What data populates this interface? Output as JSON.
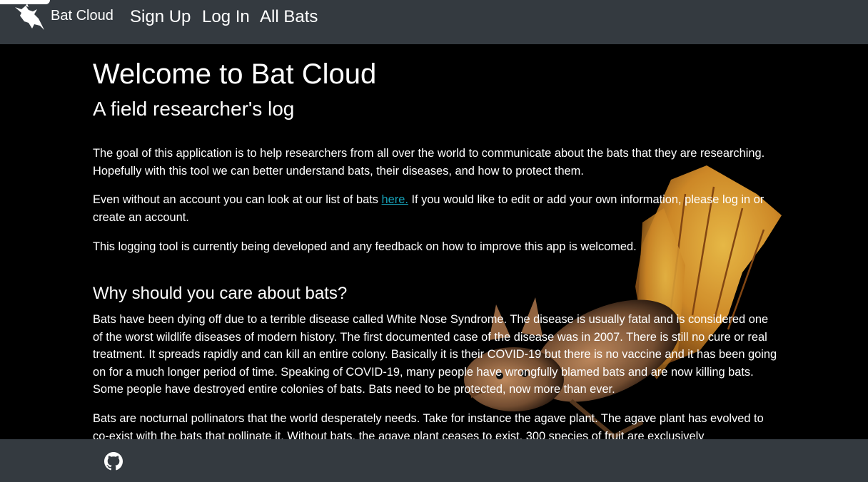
{
  "navbar": {
    "brand": "Bat Cloud",
    "links": [
      "Sign Up",
      "Log In",
      "All Bats"
    ]
  },
  "main": {
    "title": "Welcome to Bat Cloud",
    "subtitle": "A field researcher's log",
    "intro": "The goal of this application is to help researchers from all over the world to communicate about the bats that they are researching. Hopefully with this tool we can better understand bats, their diseases, and how to protect them.",
    "account_before": "Even without an account you can look at our list of bats ",
    "account_link": "here.",
    "account_after": " If you would like to edit or add your own information, please log in or create an account.",
    "feedback": "This logging tool is currently being developed and any feedback on how to improve this app is welcomed.",
    "why_heading": "Why should you care about bats?",
    "why_p1": "Bats have been dying off due to a terrible disease called White Nose Syndrome. The disease is usually fatal and is considered one of the worst wildlife diseases of modern history. The first documented case of the disease was in 2007. There is still no cure or real treatment. It spreads rapidly and can kill an entire colony. Basically it is their COVID-19 but there is no vaccine and it has been going on for a much longer period of time. Speaking of COVID-19, many people have wrongfully blamed bats and are now killing bats. Some people have destroyed entire colonies of bats. Bats need to be protected, now more than ever.",
    "why_p2": "Bats are nocturnal pollinators that the world desperately needs. Take for instance the agave plant. The agave plant has evolved to co-exist with the bats that pollinate it. Without bats, the agave plant ceases to exist. 300 species of fruit are exclusively"
  },
  "footer": {
    "icon": "github-icon"
  },
  "colors": {
    "navbar": "#343a40",
    "link": "#17a2b8",
    "background": "#000000"
  }
}
